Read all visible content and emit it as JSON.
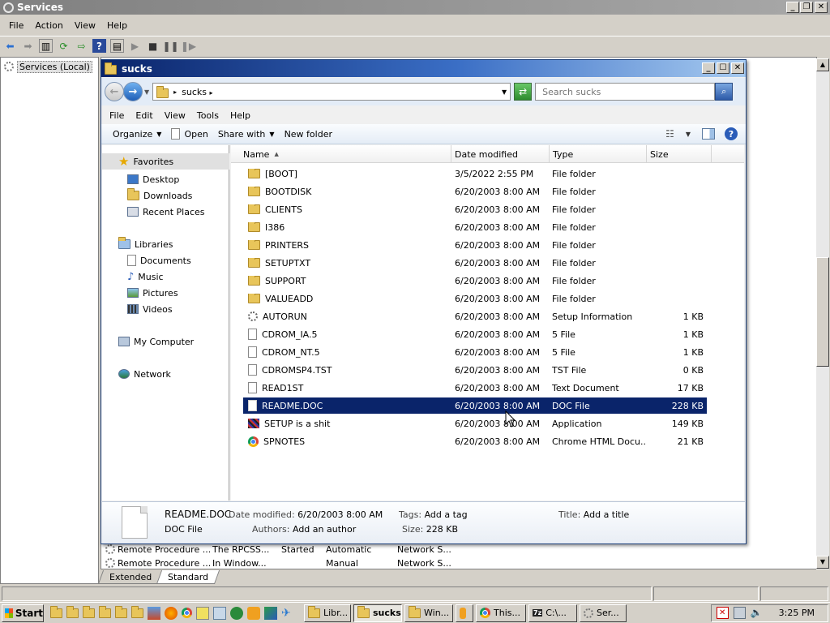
{
  "services_window": {
    "title": "Services",
    "menu": [
      "File",
      "Action",
      "View",
      "Help"
    ],
    "tree_root": "Services (Local)",
    "rows": [
      {
        "name": "Remote Procedure ...",
        "description": "The RPCSS...",
        "status": "Started",
        "startup": "Automatic",
        "logon": "Network S..."
      },
      {
        "name": "Remote Procedure ...",
        "description": "In Window...",
        "status": "",
        "startup": "Manual",
        "logon": "Network S..."
      }
    ],
    "tabs": [
      "Extended",
      "Standard"
    ],
    "active_tab": "Standard"
  },
  "explorer": {
    "title": "sucks",
    "breadcrumb": "sucks",
    "search_placeholder": "Search sucks",
    "menu": [
      "File",
      "Edit",
      "View",
      "Tools",
      "Help"
    ],
    "commands": {
      "organize": "Organize",
      "open": "Open",
      "share_with": "Share with",
      "new_folder": "New folder"
    },
    "nav": {
      "favorites": "Favorites",
      "desktop": "Desktop",
      "downloads": "Downloads",
      "recent_places": "Recent Places",
      "libraries": "Libraries",
      "documents": "Documents",
      "music": "Music",
      "pictures": "Pictures",
      "videos": "Videos",
      "my_computer": "My Computer",
      "network": "Network"
    },
    "columns": {
      "name": "Name",
      "date": "Date modified",
      "type": "Type",
      "size": "Size"
    },
    "files": [
      {
        "name": "[BOOT]",
        "date": "3/5/2022 2:55 PM",
        "type": "File folder",
        "size": "",
        "icon": "folder"
      },
      {
        "name": "BOOTDISK",
        "date": "6/20/2003 8:00 AM",
        "type": "File folder",
        "size": "",
        "icon": "folder"
      },
      {
        "name": "CLIENTS",
        "date": "6/20/2003 8:00 AM",
        "type": "File folder",
        "size": "",
        "icon": "folder"
      },
      {
        "name": "I386",
        "date": "6/20/2003 8:00 AM",
        "type": "File folder",
        "size": "",
        "icon": "folder"
      },
      {
        "name": "PRINTERS",
        "date": "6/20/2003 8:00 AM",
        "type": "File folder",
        "size": "",
        "icon": "folder"
      },
      {
        "name": "SETUPTXT",
        "date": "6/20/2003 8:00 AM",
        "type": "File folder",
        "size": "",
        "icon": "folder"
      },
      {
        "name": "SUPPORT",
        "date": "6/20/2003 8:00 AM",
        "type": "File folder",
        "size": "",
        "icon": "folder"
      },
      {
        "name": "VALUEADD",
        "date": "6/20/2003 8:00 AM",
        "type": "File folder",
        "size": "",
        "icon": "folder"
      },
      {
        "name": "AUTORUN",
        "date": "6/20/2003 8:00 AM",
        "type": "Setup Information",
        "size": "1 KB",
        "icon": "gear"
      },
      {
        "name": "CDROM_IA.5",
        "date": "6/20/2003 8:00 AM",
        "type": "5 File",
        "size": "1 KB",
        "icon": "doc"
      },
      {
        "name": "CDROM_NT.5",
        "date": "6/20/2003 8:00 AM",
        "type": "5 File",
        "size": "1 KB",
        "icon": "doc"
      },
      {
        "name": "CDROMSP4.TST",
        "date": "6/20/2003 8:00 AM",
        "type": "TST File",
        "size": "0 KB",
        "icon": "doc"
      },
      {
        "name": "READ1ST",
        "date": "6/20/2003 8:00 AM",
        "type": "Text Document",
        "size": "17 KB",
        "icon": "doc"
      },
      {
        "name": "README.DOC",
        "date": "6/20/2003 8:00 AM",
        "type": "DOC File",
        "size": "228 KB",
        "icon": "doc",
        "selected": true
      },
      {
        "name": "SETUP is a shit",
        "date": "6/20/2003 8:00 AM",
        "type": "Application",
        "size": "149 KB",
        "icon": "app"
      },
      {
        "name": "SPNOTES",
        "date": "6/20/2003 8:00 AM",
        "type": "Chrome HTML Docu...",
        "size": "21 KB",
        "icon": "chrome"
      }
    ],
    "details": {
      "filename": "README.DOC",
      "filetype": "DOC File",
      "date_label": "Date modified:",
      "date_value": "6/20/2003 8:00 AM",
      "authors_label": "Authors:",
      "authors_value": "Add an author",
      "tags_label": "Tags:",
      "tags_value": "Add a tag",
      "size_label": "Size:",
      "size_value": "228 KB",
      "title_label": "Title:",
      "title_value": "Add a title"
    }
  },
  "taskbar": {
    "start": "Start",
    "buttons": [
      "Libr...",
      "sucks",
      "Win...",
      "",
      "This...",
      "C:\\...",
      "Ser..."
    ],
    "active_button": "sucks",
    "clock": "3:25 PM"
  },
  "colors": {
    "selection": "#0a246a",
    "title_active": "#0a246a",
    "title_inactive": "#808080"
  }
}
